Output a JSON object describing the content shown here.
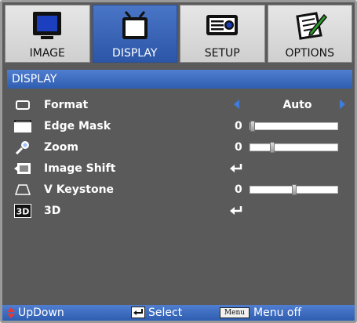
{
  "tabs": [
    {
      "label": "IMAGE",
      "icon": "monitor-icon",
      "active": false
    },
    {
      "label": "DISPLAY",
      "icon": "tv-icon",
      "active": true
    },
    {
      "label": "SETUP",
      "icon": "projector-icon",
      "active": false
    },
    {
      "label": "OPTIONS",
      "icon": "notepad-pencil-icon",
      "active": false
    }
  ],
  "section": {
    "title": "DISPLAY"
  },
  "menu": [
    {
      "label": "Format",
      "icon": "format-icon",
      "value": "Auto"
    },
    {
      "label": "Edge Mask",
      "icon": "edge-mask-icon",
      "value": "0",
      "slider": 0.0
    },
    {
      "label": "Zoom",
      "icon": "zoom-icon",
      "value": "0",
      "slider": 0.24
    },
    {
      "label": "Image Shift",
      "icon": "image-shift-icon",
      "enter": true
    },
    {
      "label": "V Keystone",
      "icon": "keystone-icon",
      "value": "0",
      "slider": 0.5
    },
    {
      "label": "3D",
      "icon": "3d-icon",
      "icon_text": "3D",
      "enter": true
    }
  ],
  "footer": {
    "updown_label": "UpDown",
    "select_label": "Select",
    "menu_key": "Menu",
    "menu_off_label": "Menu off"
  },
  "colors": {
    "accent": "#3a67bd",
    "arrow": "#3f7ce0",
    "updown_arrow": "#e23a3a",
    "background": "#5a5a5a"
  }
}
